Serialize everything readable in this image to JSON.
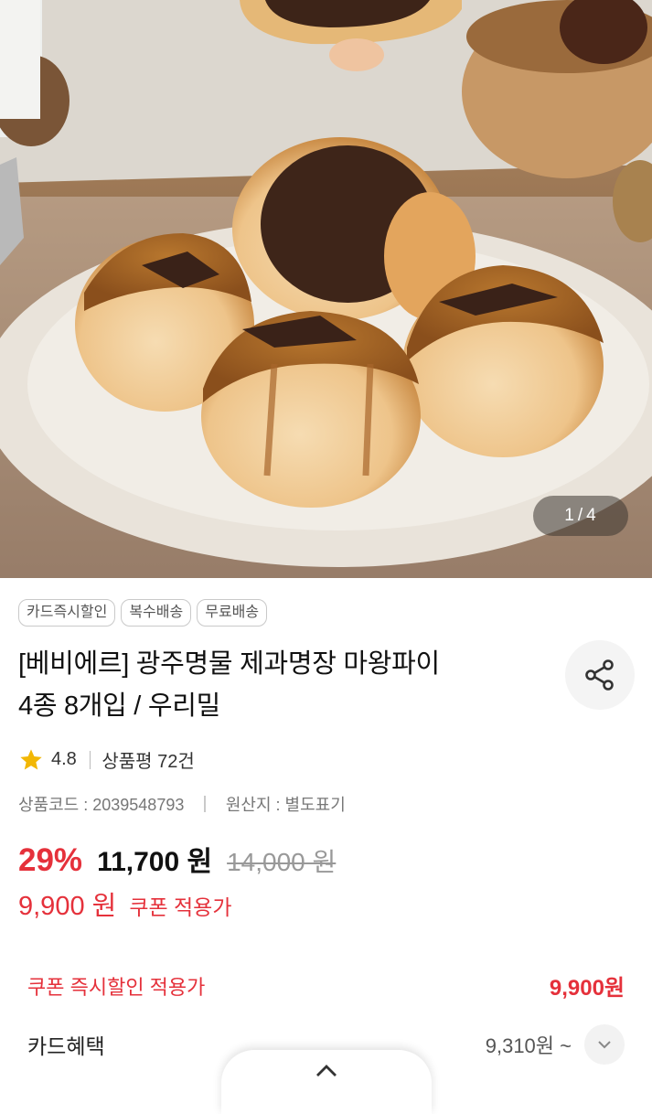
{
  "gallery": {
    "current": "1",
    "separator": "/",
    "total": "4"
  },
  "badges": [
    "카드즉시할인",
    "복수배송",
    "무료배송"
  ],
  "product": {
    "title_line1": "[베비에르] 광주명물 제과명장 마왕파이",
    "title_line2": "4종 8개입 / 우리밀"
  },
  "rating": {
    "score": "4.8",
    "reviews": "상품평 72건"
  },
  "meta": {
    "code": "상품코드 : 2039548793",
    "origin": "원산지 : 별도표기"
  },
  "price": {
    "discount": "29%",
    "sale": "11,700 원",
    "original": "14,000 원",
    "coupon_price": "9,900 원",
    "coupon_label": "쿠폰 적용가"
  },
  "instant_discount": {
    "label": "쿠폰 즉시할인 적용가",
    "value": "9,900원"
  },
  "card_benefit": {
    "label": "카드혜택",
    "value": "9,310원 ~"
  },
  "icons": {
    "share": "share-icon",
    "star": "star-icon",
    "expand": "chevron-down-icon",
    "collapse": "chevron-up-icon"
  },
  "colors": {
    "accent_red": "#e5313b",
    "star_yellow": "#f2b705"
  }
}
